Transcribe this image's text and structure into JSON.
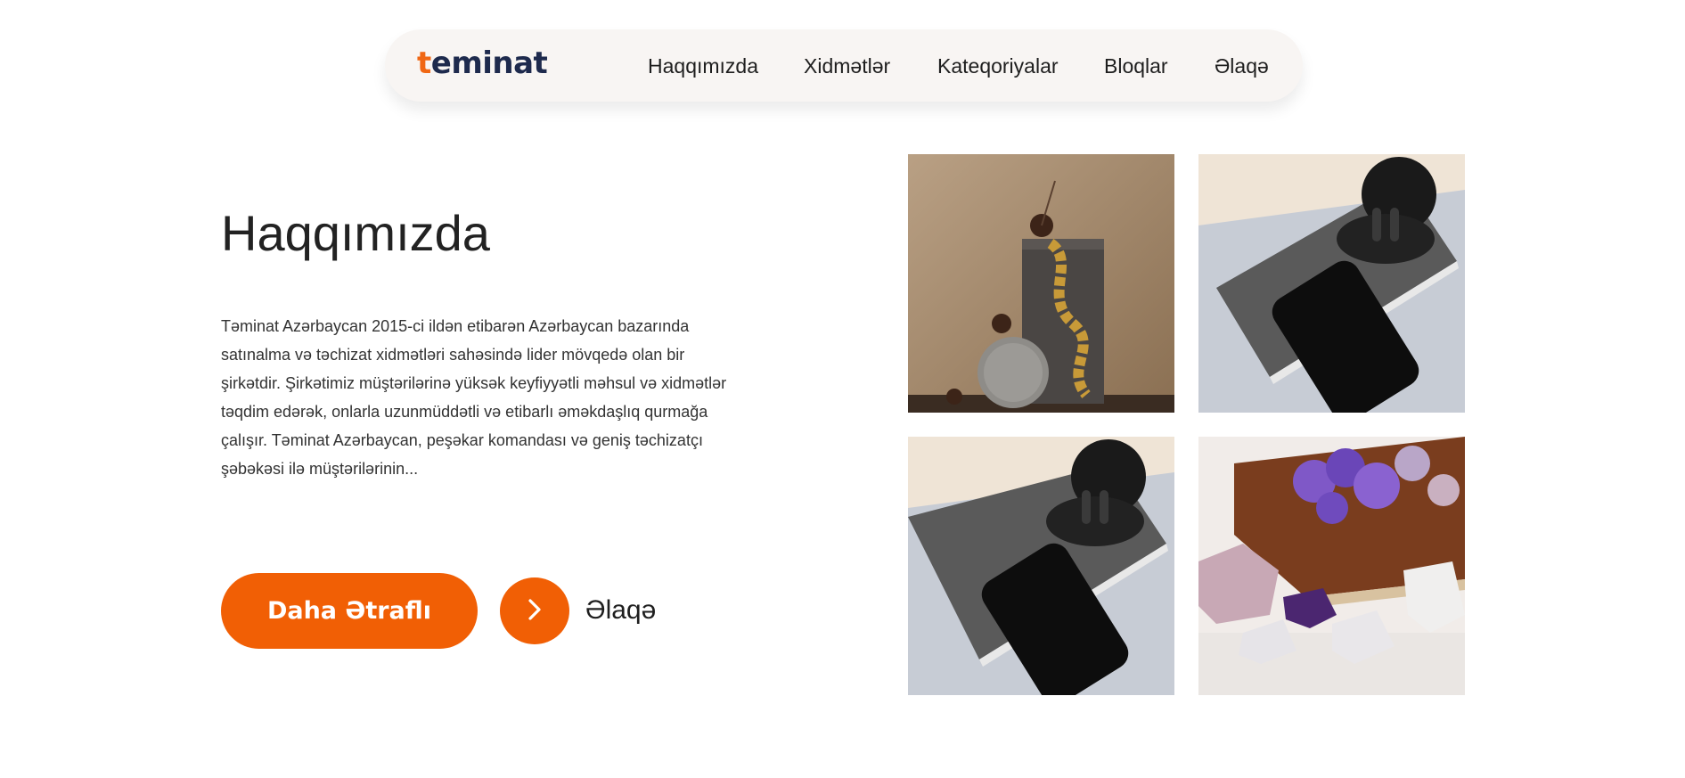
{
  "brand": {
    "logo_first": "t",
    "logo_rest": "eminat",
    "accent_color": "#f15f05",
    "navy_color": "#1e2a4d"
  },
  "nav": {
    "items": [
      {
        "label": "Haqqımızda"
      },
      {
        "label": "Xidmətlər"
      },
      {
        "label": "Kateqoriyalar"
      },
      {
        "label": "Bloqlar"
      },
      {
        "label": "Əlaqə"
      }
    ]
  },
  "about": {
    "title": "Haqqımızda",
    "text": "Təminat Azərbaycan 2015-ci ildən etibarən Azərbaycan bazarında satınalma və təchizat xidmətləri sahəsində lider mövqedə olan bir şirkətdir. Şirkətimiz müştərilərinə yüksək keyfiyyətli məhsul və xidmətlər təqdim edərək, onlarla uzunmüddətli və etibarlı əməkdaşlıq qurmağa çalışır. Təminat Azərbaycan, peşəkar komandası və geniş təchizatçı şəbəkəsi ilə müştərilərinin..."
  },
  "actions": {
    "more_label": "Daha Ətraflı",
    "contact_label": "Əlaqə",
    "arrow_icon": "chevron-right-icon"
  },
  "gallery": {
    "images": [
      {
        "name": "gold-chain-on-stone-block"
      },
      {
        "name": "earbuds-and-phone-on-notebook"
      },
      {
        "name": "earbuds-and-phone-on-notebook-2"
      },
      {
        "name": "purple-flowers-book-and-crystals"
      }
    ]
  }
}
